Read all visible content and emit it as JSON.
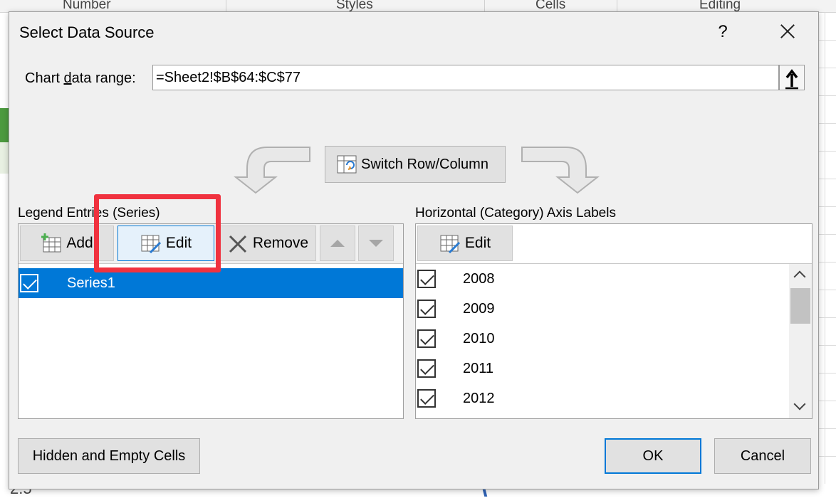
{
  "background": {
    "ribbon_groups": [
      "Number",
      "Styles",
      "Cells",
      "Editing"
    ],
    "bottom_text": "2.5"
  },
  "dialog": {
    "title": "Select Data Source",
    "help_label": "?",
    "chart_range_label": "Chart data range:",
    "chart_range_value": "=Sheet2!$B$64:$C$77",
    "switch_label": "Switch Row/Column",
    "legend": {
      "header": "Legend Entries (Series)",
      "add_label": "Add",
      "edit_label": "Edit",
      "remove_label": "Remove",
      "series": [
        "Series1"
      ]
    },
    "axis": {
      "header": "Horizontal (Category) Axis Labels",
      "edit_label": "Edit",
      "items": [
        "2008",
        "2009",
        "2010",
        "2011",
        "2012"
      ]
    },
    "hidden_empty_label": "Hidden and Empty Cells",
    "ok_label": "OK",
    "cancel_label": "Cancel"
  },
  "colors": {
    "accent": "#0078d7",
    "highlight": "#f0323f"
  }
}
